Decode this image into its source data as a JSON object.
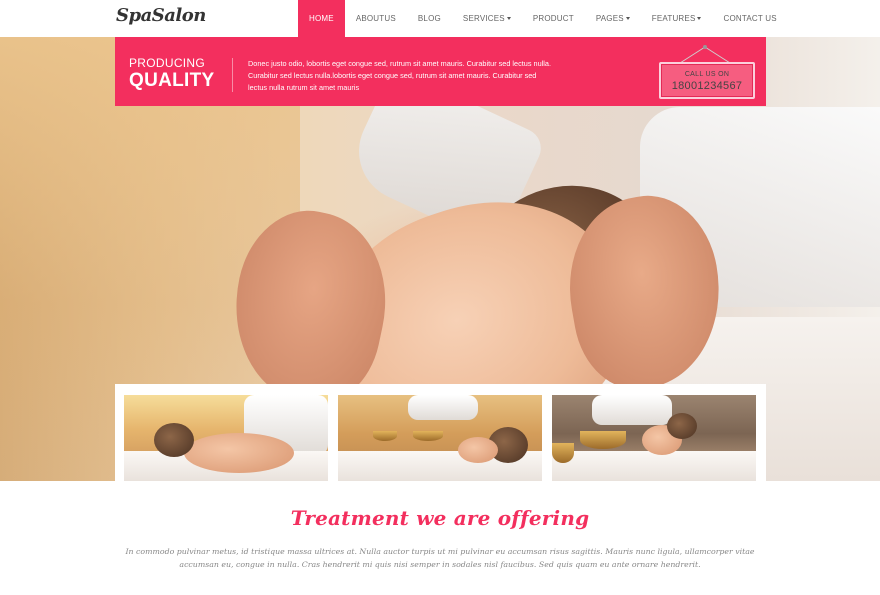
{
  "brand": {
    "logo_text": "SpaSalon"
  },
  "nav": {
    "items": [
      {
        "label": "HOME",
        "active": true,
        "dropdown": false
      },
      {
        "label": "ABOUTUS",
        "active": false,
        "dropdown": false
      },
      {
        "label": "BLOG",
        "active": false,
        "dropdown": false
      },
      {
        "label": "SERVICES",
        "active": false,
        "dropdown": true
      },
      {
        "label": "PRODUCT",
        "active": false,
        "dropdown": false
      },
      {
        "label": "PAGES",
        "active": false,
        "dropdown": true
      },
      {
        "label": "FEATURES",
        "active": false,
        "dropdown": true
      },
      {
        "label": "CONTACT US",
        "active": false,
        "dropdown": false
      }
    ]
  },
  "banner": {
    "line1": "PRODUCING",
    "line2": "QUALITY",
    "description": "Donec justo odio, lobortis eget congue sed, rutrum sit amet mauris. Curabitur sed lectus nulla. Curabitur sed lectus nulla.lobortis eget congue sed, rutrum sit amet mauris. Curabitur sed lectus nulla rutrum sit amet mauris",
    "call_label": "CALL US ON",
    "phone": "18001234567"
  },
  "section": {
    "title": "Treatment we are offering",
    "text": "In commodo pulvinar metus, id tristique massa ultrices at. Nulla auctor turpis ut mi pulvinar eu accumsan risus sagittis. Mauris nunc ligula, ullamcorper vitae accumsan eu, congue in nulla. Cras hendrerit mi quis nisi semper in sodales nisl faucibus. Sed quis quam eu ante ornare hendrerit."
  },
  "colors": {
    "accent": "#f32f5e"
  }
}
